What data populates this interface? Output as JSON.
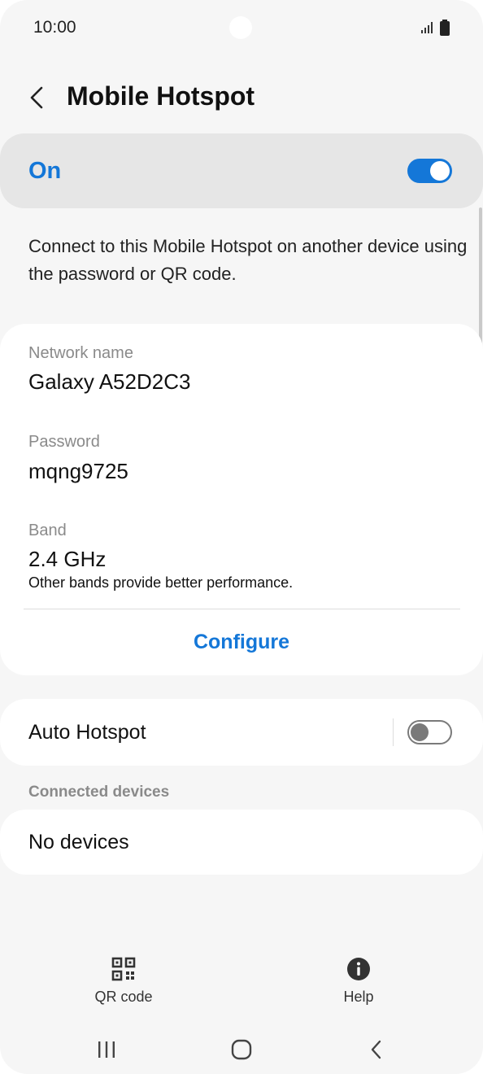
{
  "status_bar": {
    "time": "10:00",
    "icons": [
      "signal-icon",
      "battery-icon"
    ]
  },
  "header": {
    "back_icon": "chevron-left-icon",
    "title": "Mobile Hotspot"
  },
  "master_switch": {
    "label": "On",
    "state": "on"
  },
  "description": "Connect to this Mobile Hotspot on another device using the password or QR code.",
  "network": {
    "name_label": "Network name",
    "name_value": "Galaxy A52D2C3",
    "password_label": "Password",
    "password_value": "mqng9725",
    "band_label": "Band",
    "band_value": "2.4 GHz",
    "band_note": "Other bands provide better performance.",
    "configure_label": "Configure"
  },
  "auto_hotspot": {
    "label": "Auto Hotspot",
    "state": "off"
  },
  "connected_devices": {
    "header": "Connected devices",
    "empty_label": "No devices"
  },
  "bottom_actions": {
    "qr_label": "QR code",
    "qr_icon": "qr-code-icon",
    "help_label": "Help",
    "help_icon": "info-icon"
  },
  "nav_bar": {
    "icons": [
      "recent-apps-icon",
      "home-icon",
      "back-icon"
    ]
  },
  "colors": {
    "accent": "#1477d8",
    "background": "#f6f6f6",
    "card": "#ffffff",
    "master_card": "#e6e6e6"
  }
}
